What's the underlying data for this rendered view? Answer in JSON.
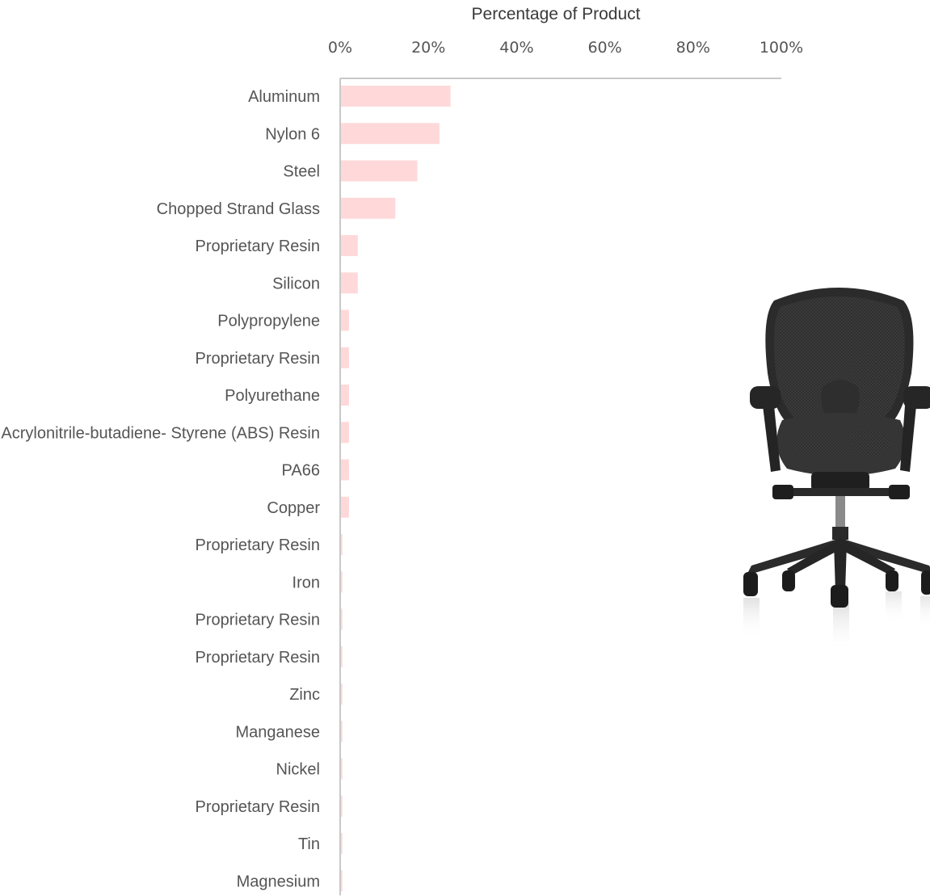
{
  "chart_data": {
    "type": "bar",
    "orientation": "horizontal",
    "title": "Percentage of Product",
    "xlabel": "Percentage of Product",
    "ylabel": "",
    "xlim": [
      0,
      100
    ],
    "axis_position": "top",
    "ticks": [
      "0%",
      "20%",
      "40%",
      "60%",
      "80%",
      "100%"
    ],
    "grid": false,
    "legend": "none",
    "categories": [
      "Aluminum",
      "Nylon 6",
      "Steel",
      "Chopped Strand Glass",
      "Proprietary Resin",
      "Silicon",
      "Polypropylene",
      "Proprietary Resin",
      "Polyurethane",
      "Acrylonitrile-butadiene- Styrene (ABS) Resin",
      "PA66",
      "Copper",
      "Proprietary Resin",
      "Iron",
      "Proprietary Resin",
      "Proprietary Resin",
      "Zinc",
      "Manganese",
      "Nickel",
      "Proprietary Resin",
      "Tin",
      "Magnesium"
    ],
    "values": [
      25,
      22.5,
      17.5,
      12.5,
      4,
      4,
      2,
      2,
      2,
      2,
      2,
      2,
      0.5,
      0.5,
      0.5,
      0.5,
      0.5,
      0.5,
      0.5,
      0.5,
      0.5,
      0.5
    ],
    "bar_color": "#ffd9da",
    "axis_color": "#c8c8c8"
  },
  "image": {
    "subject": "office-chair-icon"
  }
}
